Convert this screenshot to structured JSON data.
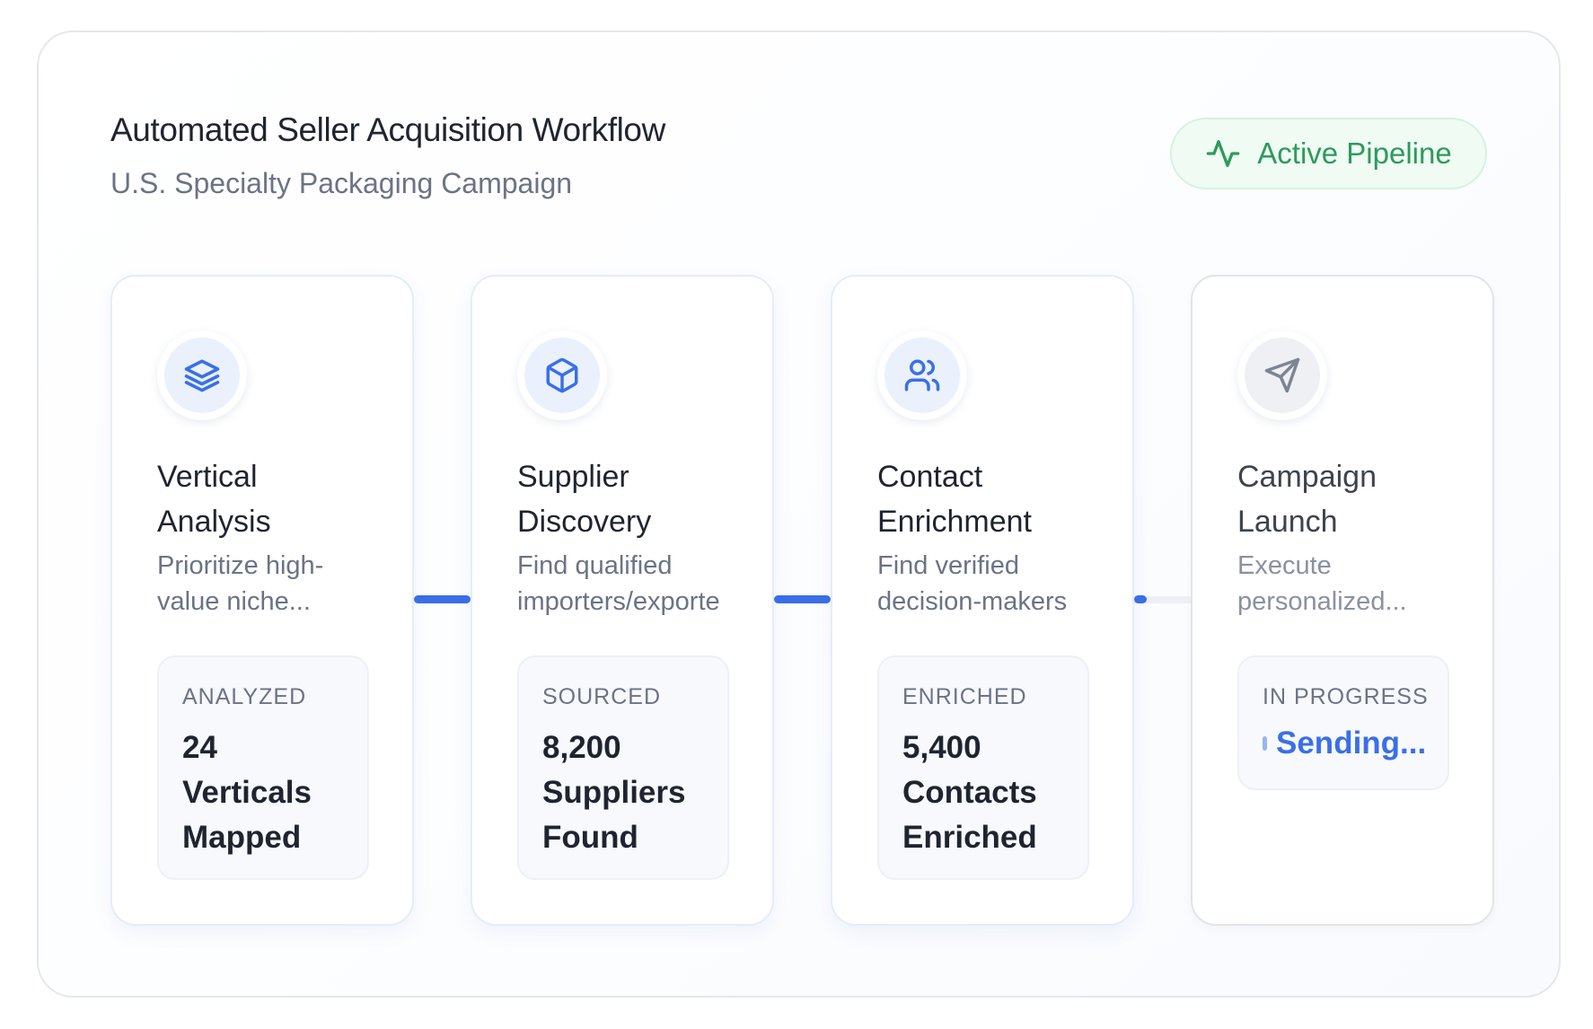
{
  "header": {
    "title": "Automated Seller Acquisition Workflow",
    "subtitle": "U.S. Specialty Packaging Campaign",
    "status_badge": "Active Pipeline"
  },
  "colors": {
    "accent": "#3a6fe8",
    "badge_text": "#2f9a5c",
    "badge_bg": "#effbf3"
  },
  "steps": [
    {
      "icon": "layers-icon",
      "title_lines": [
        "Vertical",
        "Analysis"
      ],
      "desc_lines": [
        "Prioritize high-",
        "value niche..."
      ],
      "stat_label": "ANALYZED",
      "stat_lines": [
        "24",
        "Verticals",
        "Mapped"
      ],
      "state": "complete"
    },
    {
      "icon": "package-icon",
      "title_lines": [
        "Supplier",
        "Discovery"
      ],
      "desc_lines": [
        "Find qualified",
        "importers/exporte"
      ],
      "stat_label": "SOURCED",
      "stat_lines": [
        "8,200",
        "Suppliers",
        "Found"
      ],
      "state": "complete"
    },
    {
      "icon": "users-icon",
      "title_lines": [
        "Contact",
        "Enrichment"
      ],
      "desc_lines": [
        "Find verified",
        "decision-makers"
      ],
      "stat_label": "ENRICHED",
      "stat_lines": [
        "5,400",
        "Contacts",
        "Enriched"
      ],
      "state": "complete"
    },
    {
      "icon": "send-icon",
      "title_lines": [
        "Campaign",
        "Launch"
      ],
      "desc_lines": [
        "Execute",
        "personalized..."
      ],
      "stat_label": "IN PROGRESS",
      "stat_status": "Sending...",
      "state": "in-progress"
    }
  ]
}
